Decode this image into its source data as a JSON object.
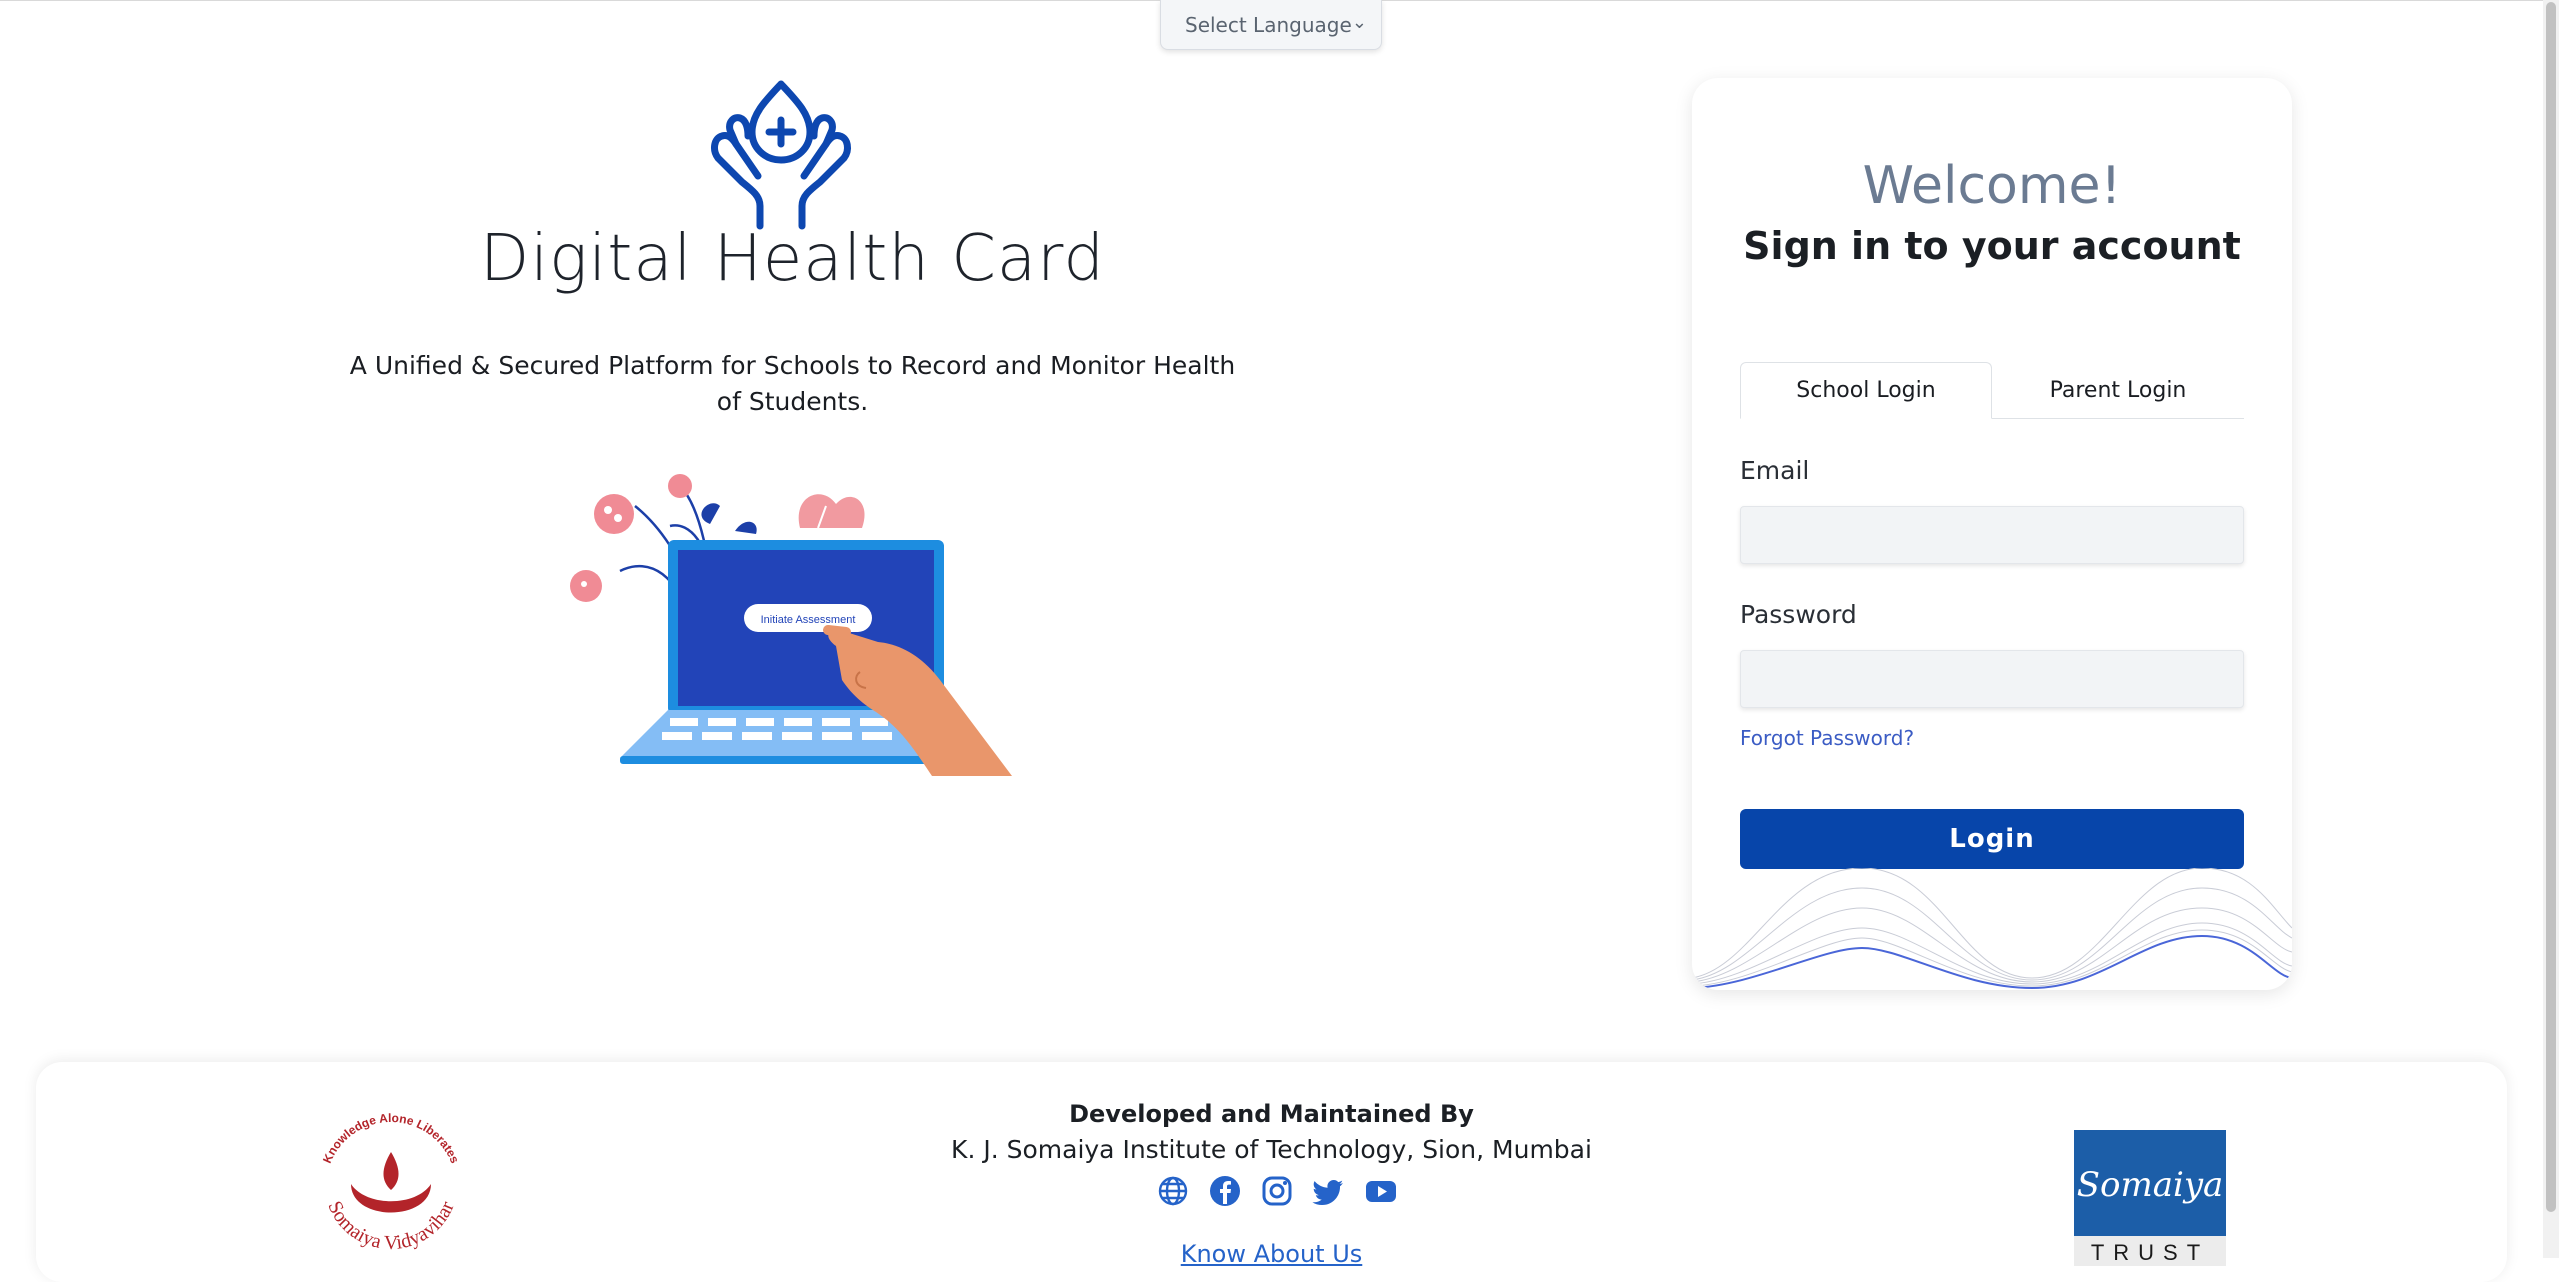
{
  "language_selector": {
    "label": "Select Language"
  },
  "brand": {
    "title": "Digital Health Card",
    "tagline": "A Unified & Secured Platform for Schools to Record and Monitor Health of Students.",
    "illustration_button": "Initiate Assessment"
  },
  "login_card": {
    "welcome": "Welcome!",
    "subtitle": "Sign in to your account",
    "tabs": [
      {
        "label": "School Login",
        "active": true
      },
      {
        "label": "Parent Login",
        "active": false
      }
    ],
    "email_label": "Email",
    "email_value": "",
    "password_label": "Password",
    "password_value": "",
    "forgot_password": "Forgot Password?",
    "login_button": "Login"
  },
  "footer": {
    "developed_by": "Developed and Maintained By",
    "institute": "K. J. Somaiya Institute of Technology, Sion, Mumbai",
    "social_icons": [
      "globe-icon",
      "facebook-icon",
      "instagram-icon",
      "twitter-icon",
      "youtube-icon"
    ],
    "know_about_us": "Know About Us",
    "left_logo_motto": "Knowledge Alone Liberates",
    "left_logo_name": "Somaiya Vidyavihar",
    "right_logo_name": "Somaiya",
    "right_logo_subtitle": "TRUST"
  },
  "colors": {
    "primary": "#0745aa",
    "welcome_text": "#6b7b92",
    "link": "#3b5cc4",
    "footer_red": "#b3242a",
    "trust_blue": "#1c5ea8"
  }
}
